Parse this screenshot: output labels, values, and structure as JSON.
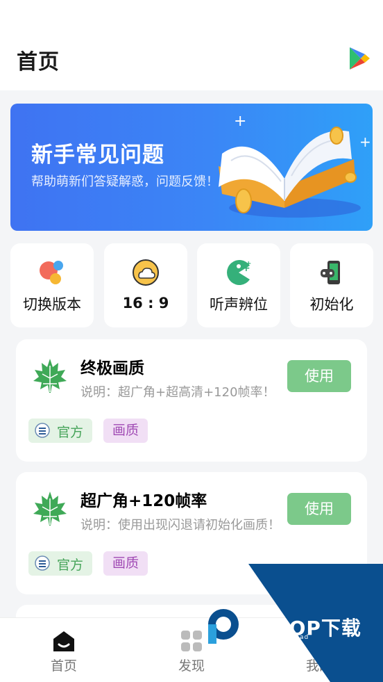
{
  "header": {
    "title": "首页",
    "store_icon": "google-play-icon"
  },
  "banner": {
    "title": "新手常见问题",
    "subtitle": "帮助萌新们答疑解惑，问题反馈！",
    "illustration": "open-book-coins-icon"
  },
  "quick_actions": [
    {
      "label": "切换版本",
      "icon": "color-dots-icon"
    },
    {
      "label": "16 : 9",
      "icon": "cloud-icon"
    },
    {
      "label": "听声辨位",
      "icon": "pacman-icon"
    },
    {
      "label": "初始化",
      "icon": "gamepad-phone-icon"
    }
  ],
  "cards": [
    {
      "title": "终极画质",
      "desc": "说明：超广角+超高清+120帧率！",
      "button": "使用",
      "tag_official": "官方",
      "tag_quality": "画质"
    },
    {
      "title": "超广角+120帧率",
      "desc": "说明：使用出现闪退请初始化画质！",
      "button": "使用",
      "tag_official": "官方",
      "tag_quality": "画质"
    }
  ],
  "tabbar": [
    {
      "label": "首页",
      "icon": "home-icon",
      "active": true
    },
    {
      "label": "发现",
      "icon": "discover-grid-icon",
      "active": false
    },
    {
      "label": "我的",
      "icon": "profile-icon",
      "active": false
    }
  ],
  "watermark": {
    "text": "PCPOP下载",
    "sub": "PCPOP Download"
  },
  "colors": {
    "accent_green": "#7cc98a",
    "banner_blue": "#3f73f2",
    "tag_purple": "#a04ab4",
    "watermark_blue": "#0a4f8f"
  }
}
